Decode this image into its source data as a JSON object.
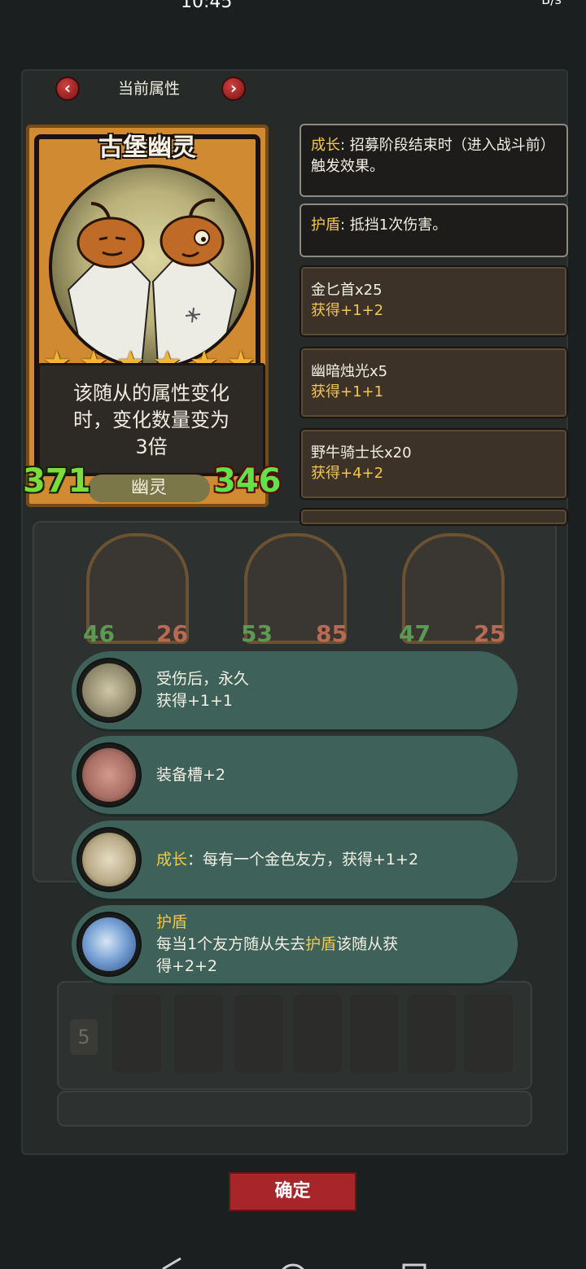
{
  "status_bar": {
    "time": "10:45",
    "right": "B/s"
  },
  "header": {
    "title": "当前属性"
  },
  "unit": {
    "name": "古堡幽灵",
    "stars": 6,
    "description_line1": "该随从的属性变化",
    "description_line2": "时，变化数量变为",
    "description_line3": "3倍",
    "attack": "371",
    "health": "346",
    "tribe": "幽灵"
  },
  "keywords": [
    {
      "name": "成长",
      "text": ": 招募阶段结束时（进入战斗前）触发效果。"
    },
    {
      "name": "护盾",
      "text": ": 抵挡1次伤害。"
    }
  ],
  "effects": [
    {
      "title": "金匕首x25",
      "sub": "获得+1+2"
    },
    {
      "title": "幽暗烛光x5",
      "sub": "获得+1+1"
    },
    {
      "title": "野牛骑士长x20",
      "sub": "获得+4+2"
    }
  ],
  "board": [
    {
      "atk": "46",
      "hp": "26"
    },
    {
      "atk": "53",
      "hp": "85"
    },
    {
      "atk": "47",
      "hp": "25"
    }
  ],
  "abilities": {
    "a1_line1": "受伤后，永久",
    "a1_line2": "获得+1+1",
    "a2_line1": "装备槽+2",
    "a3_kw": "成长",
    "a3_text": "：每有一个金色友方，获得+1+2",
    "a4_kw": "护盾",
    "a4_line1_pre": "每当1个友方随从失去",
    "a4_line1_kw": "护盾",
    "a4_line1_post": "该随从获",
    "a4_line2": "得+2+2"
  },
  "shop": {
    "tier": "5"
  },
  "confirm": {
    "label": "确定"
  },
  "colors": {
    "card_gold": "#d08a31",
    "pill_green": "#3e6259",
    "keyword_gold": "#f2c84b",
    "attack_green": "#7ddb3c",
    "confirm_red": "#a8262a"
  }
}
